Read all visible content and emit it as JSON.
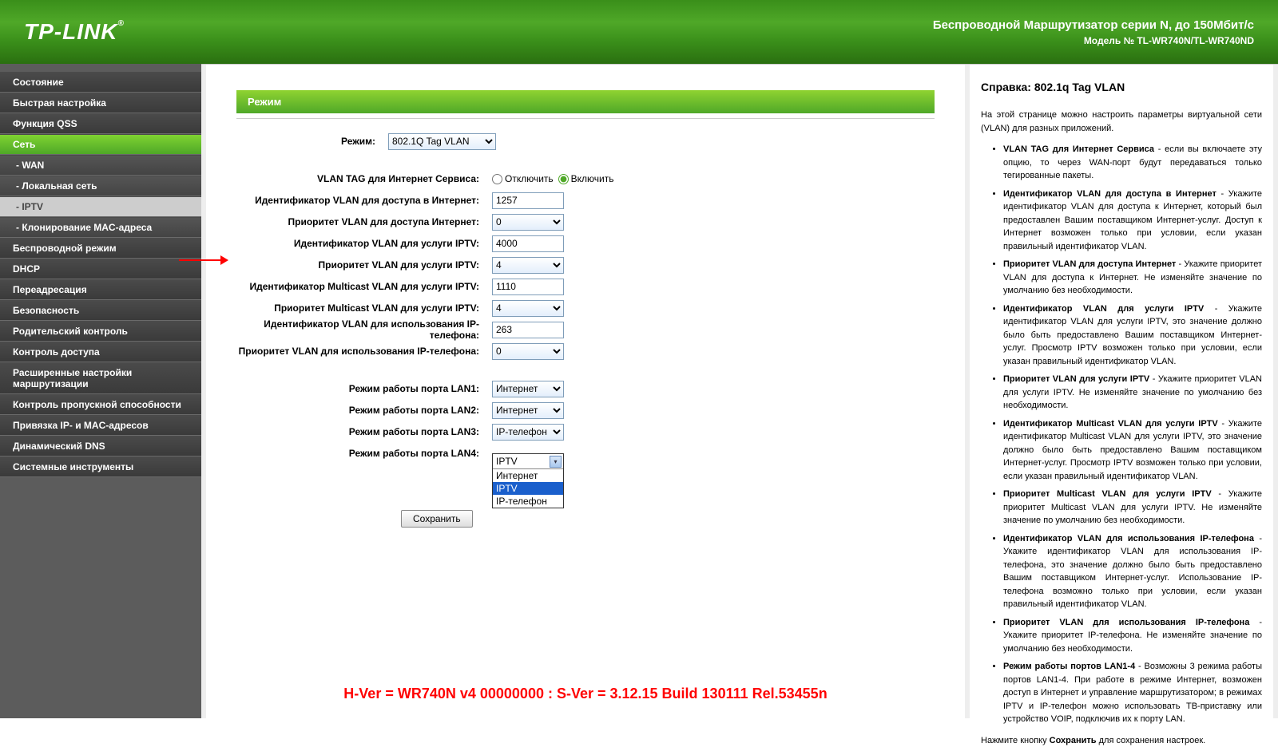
{
  "header": {
    "logo": "TP-LINK",
    "title": "Беспроводной Маршрутизатор серии N, до 150Мбит/с",
    "model": "Модель № TL-WR740N/TL-WR740ND"
  },
  "sidebar": {
    "items": [
      {
        "label": "Состояние",
        "type": "top"
      },
      {
        "label": "Быстрая настройка",
        "type": "top"
      },
      {
        "label": "Функция QSS",
        "type": "top"
      },
      {
        "label": "Сеть",
        "type": "top-active"
      },
      {
        "label": "- WAN",
        "type": "sub"
      },
      {
        "label": "- Локальная сеть",
        "type": "sub"
      },
      {
        "label": "- IPTV",
        "type": "sub-active"
      },
      {
        "label": "- Клонирование MAC-адреса",
        "type": "sub"
      },
      {
        "label": "Беспроводной режим",
        "type": "top"
      },
      {
        "label": "DHCP",
        "type": "top"
      },
      {
        "label": "Переадресация",
        "type": "top"
      },
      {
        "label": "Безопасность",
        "type": "top"
      },
      {
        "label": "Родительский контроль",
        "type": "top"
      },
      {
        "label": "Контроль доступа",
        "type": "top"
      },
      {
        "label": "Расширенные настройки маршрутизации",
        "type": "top"
      },
      {
        "label": "Контроль пропускной способности",
        "type": "top"
      },
      {
        "label": "Привязка IP- и MAC-адресов",
        "type": "top"
      },
      {
        "label": "Динамический DNS",
        "type": "top"
      },
      {
        "label": "Системные инструменты",
        "type": "top"
      }
    ]
  },
  "main": {
    "section_title": "Режим",
    "mode_label": "Режим:",
    "mode_value": "802.1Q Tag VLAN",
    "fields": {
      "vlan_tag_label": "VLAN TAG для Интернет Сервиса:",
      "vlan_tag_off": "Отключить",
      "vlan_tag_on": "Включить",
      "internet_vlan_id_label": "Идентификатор VLAN для доступа в Интернет:",
      "internet_vlan_id": "1257",
      "internet_prio_label": "Приоритет VLAN для доступа Интернет:",
      "internet_prio": "0",
      "iptv_vlan_id_label": "Идентификатор VLAN для услуги IPTV:",
      "iptv_vlan_id": "4000",
      "iptv_prio_label": "Приоритет VLAN для услуги IPTV:",
      "iptv_prio": "4",
      "mcast_vlan_id_label": "Идентификатор Multicast VLAN для услуги IPTV:",
      "mcast_vlan_id": "1110",
      "mcast_prio_label": "Приоритет Multicast VLAN для услуги IPTV:",
      "mcast_prio": "4",
      "phone_vlan_id_label": "Идентификатор VLAN для использования IP-телефона:",
      "phone_vlan_id": "263",
      "phone_prio_label": "Приоритет VLAN для использования IP-телефона:",
      "phone_prio": "0",
      "lan1_label": "Режим работы порта LAN1:",
      "lan1_value": "Интернет",
      "lan2_label": "Режим работы порта LAN2:",
      "lan2_value": "Интернет",
      "lan3_label": "Режим работы порта LAN3:",
      "lan3_value": "IP-телефон",
      "lan4_label": "Режим работы порта LAN4:",
      "lan4_value": "IPTV",
      "lan4_options": [
        "Интернет",
        "IPTV",
        "IP-телефон"
      ]
    },
    "save": "Сохранить",
    "version": "H-Ver = WR740N v4 00000000 : S-Ver = 3.12.15 Build 130111 Rel.53455n"
  },
  "help": {
    "title": "Справка: 802.1q Tag VLAN",
    "intro": "На этой странице можно настроить параметры виртуальной сети (VLAN) для разных приложений.",
    "b1": "VLAN TAG для Интернет Сервиса",
    "t1": " - если вы включаете эту опцию, то через WAN-порт будут передаваться только тегированные пакеты.",
    "b2": "Идентификатор VLAN для доступа в Интернет",
    "t2": " - Укажите идентификатор VLAN для доступа к Интернет, который был предоставлен Вашим поставщиком Интернет-услуг. Доступ к Интернет возможен только при условии, если указан правильный идентификатор VLAN.",
    "b3": "Приоритет VLAN для доступа Интернет",
    "t3": " - Укажите приоритет VLAN для доступа к Интернет. Не изменяйте значение по умолчанию без необходимости.",
    "b4": "Идентификатор VLAN для услуги IPTV",
    "t4": " - Укажите идентификатор VLAN для услуги IPTV, это значение должно было быть предоставлено Вашим поставщиком Интернет-услуг. Просмотр IPTV возможен только при условии, если указан правильный идентификатор VLAN.",
    "b5": "Приоритет VLAN для услуги IPTV",
    "t5": " - Укажите приоритет VLAN для услуги IPTV. Не изменяйте значение по умолчанию без необходимости.",
    "b6": "Идентификатор Multicast VLAN для услуги IPTV",
    "t6": " - Укажите идентификатор Multicast VLAN для услуги IPTV, это значение должно было быть предоставлено Вашим поставщиком Интернет-услуг. Просмотр IPTV возможен только при условии, если указан правильный идентификатор VLAN.",
    "b7": "Приоритет Multicast VLAN для услуги IPTV",
    "t7": " - Укажите приоритет Multicast VLAN для услуги IPTV. Не изменяйте значение по умолчанию без необходимости.",
    "b8": "Идентификатор VLAN для использования IP-телефона",
    "t8": " - Укажите идентификатор VLAN для использования IP-телефона, это значение должно было быть предоставлено Вашим поставщиком Интернет-услуг. Использование IP-телефона возможно только при условии, если указан правильный идентификатор VLAN.",
    "b9": "Приоритет VLAN для использования IP-телефона",
    "t9": " - Укажите приоритет IP-телефона. Не изменяйте значение по умолчанию без необходимости.",
    "b10": "Режим работы портов LAN1-4",
    "t10": " - Возможны 3 режима работы портов LAN1-4. При работе в режиме Интернет, возможен доступ в Интернет и управление маршрутизатором; в режимах IPTV и IP-телефон можно использовать ТВ-приставку или устройство VOIP, подключив их к порту LAN.",
    "footer_pre": "Нажмите кнопку ",
    "footer_b": "Сохранить",
    "footer_post": " для сохранения настроек."
  }
}
